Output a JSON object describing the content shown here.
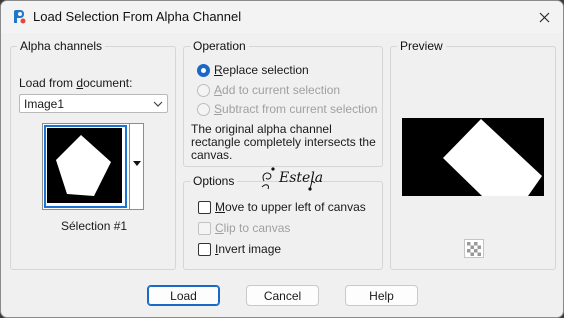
{
  "window": {
    "title": "Load Selection From Alpha Channel"
  },
  "alpha_channels": {
    "legend": "Alpha channels",
    "load_from_label_pre": "Load from ",
    "load_from_label_acc": "d",
    "load_from_label_post": "ocument:",
    "document_value": "Image1",
    "selection_name": "Sélection #1"
  },
  "operation": {
    "legend": "Operation",
    "options": [
      {
        "acc": "R",
        "rest": "eplace selection",
        "selected": true,
        "enabled": true
      },
      {
        "acc": "A",
        "rest": "dd to current selection",
        "selected": false,
        "enabled": false
      },
      {
        "acc": "S",
        "rest": "ubtract from current selection",
        "selected": false,
        "enabled": false
      }
    ],
    "info_text": "The original alpha channel rectangle completely intersects the canvas."
  },
  "options": {
    "legend": "Options",
    "items": [
      {
        "acc": "M",
        "rest": "ove to upper left of canvas",
        "checked": false,
        "enabled": true
      },
      {
        "acc": "C",
        "rest": "lip to canvas",
        "checked": false,
        "enabled": false
      },
      {
        "acc": "I",
        "rest": "nvert image",
        "checked": false,
        "enabled": true
      }
    ]
  },
  "preview": {
    "legend": "Preview"
  },
  "buttons": {
    "load": "Load",
    "cancel": "Cancel",
    "help": "Help"
  },
  "watermark": {
    "text": "Estela"
  },
  "colors": {
    "accent": "#1a68c7",
    "selection_frame": "#1a74d6"
  },
  "icons": {
    "app": "app-icon",
    "close": "close-icon",
    "dropdown": "chevron-down-icon",
    "thumb_dropdown": "triangle-down-icon",
    "preview_mode": "checkerboard-icon"
  }
}
